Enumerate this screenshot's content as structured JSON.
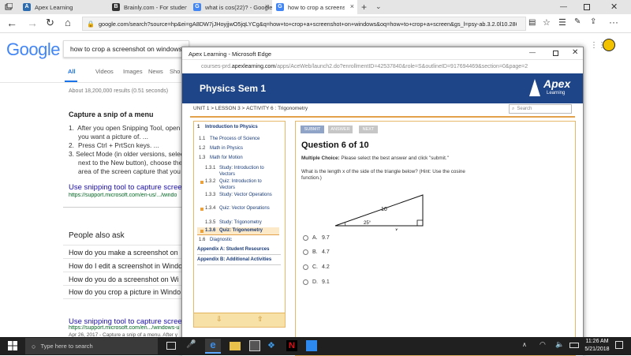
{
  "browser_tabs": [
    {
      "title": "Apex Learning",
      "color": "#2b6cb0",
      "glyph": "A"
    },
    {
      "title": "Brainly.com - For students. B",
      "color": "#333333",
      "glyph": "B"
    },
    {
      "title": "what is cos(22)? - Google Se",
      "color": "#4285f4",
      "glyph": "G"
    },
    {
      "title": "how to crop a screenshot",
      "color": "#4285f4",
      "glyph": "G"
    }
  ],
  "address_bar": {
    "url": "google.com/search?source=hp&ei=gA8DW7jJHoyjjwO5jqLYCg&q=how+to+crop+a+screenshot+on+windows&oq=how+to+crop+a+screen&gs_l=psy-ab.3.2.0l10.286.5978.0.80"
  },
  "google": {
    "logo": "Google",
    "query": "how to crop a screenshot on windows",
    "tabs": [
      "All",
      "Videos",
      "Images",
      "News",
      "Sho"
    ],
    "results_count": "About 18,200,000 results (0.51 seconds)",
    "snippet_title": "Capture a snip of a menu",
    "snippet_steps": [
      "After you open Snipping Tool, open t",
      "you want a picture of. ...",
      "Press Ctrl + PrtScn keys. ...",
      "Select Mode (in older versions, selec",
      "next to the New button), choose the k",
      "area of the screen capture that you w"
    ],
    "link1_title": "Use snipping tool to capture screen",
    "link1_url": "https://support.microsoft.com/en-us/.../windo",
    "paa_title": "People also ask",
    "paa_items": [
      "How do you make a screenshot on",
      "How do I edit a screenshot in Windo",
      "How do you do a screenshot on Wi",
      "How do you crop a picture in Windo"
    ],
    "link2_title": "Use snipping tool to capture screen",
    "link2_url": "https://support.microsoft.com/en.../windows-u",
    "link2_desc": "Apr 26, 2017 - Capture a snip of a menu. After y"
  },
  "edge": {
    "title": "Apex Learning - Microsoft Edge",
    "url_prefix": "courses-prd.",
    "url_domain": "apexlearning.com",
    "url_rest": "/apps/AceWeb/launch2.do?enrollmentID=42537840&role=S&outlineID=917694469&section=0&page=2"
  },
  "apex": {
    "course_title": "Physics Sem 1",
    "logo_text": "Apex",
    "logo_sub": "Learning",
    "breadcrumb_unit": "UNIT 1",
    "breadcrumb_lesson": "LESSON 3",
    "breadcrumb_activity": "ACTIVITY 6",
    "breadcrumb_name": "Trigonometry",
    "search_placeholder": "Search",
    "nav": [
      {
        "num": "1",
        "label": "Introduction to Physics"
      },
      {
        "num": "1.1",
        "label": "The Process of Science"
      },
      {
        "num": "1.2",
        "label": "Math in Physics"
      },
      {
        "num": "1.3",
        "label": "Math for Motion"
      },
      {
        "num": "1.3.1",
        "label": "Study: Introduction to Vectors"
      },
      {
        "num": "1.3.2",
        "label": "Quiz: Introduction to Vectors"
      },
      {
        "num": "1.3.3",
        "label": "Study: Vector Operations"
      },
      {
        "num": "1.3.4",
        "label": "Quiz: Vector Operations"
      },
      {
        "num": "1.3.5",
        "label": "Study: Trigonometry"
      },
      {
        "num": "1.3.6",
        "label": "Quiz: Trigonometry"
      },
      {
        "num": "1.6",
        "label": "Diagnostic"
      },
      {
        "num": "",
        "label": "Appendix A: Student Resources"
      },
      {
        "num": "",
        "label": "Appendix B: Additional Activities"
      }
    ],
    "buttons": {
      "submit": "SUBMIT",
      "answer": "ANSWER",
      "next": "NEXT"
    },
    "question_title": "Question 6 of 10",
    "mc_label": "Multiple Choice:",
    "mc_instruction": "Please select the best answer and click \"submit.\"",
    "question_text": "What is the length x of the side of the triangle below? (Hint: Use the cosine function.)",
    "triangle": {
      "hypotenuse": "10",
      "angle": "25°",
      "base": "x"
    },
    "options": [
      {
        "letter": "A.",
        "value": "9.7"
      },
      {
        "letter": "B.",
        "value": "4.7"
      },
      {
        "letter": "C.",
        "value": "4.2"
      },
      {
        "letter": "D.",
        "value": "9.1"
      }
    ]
  },
  "taskbar": {
    "search_placeholder": "Type here to search",
    "time": "11:26 AM",
    "date": "5/21/2018"
  }
}
